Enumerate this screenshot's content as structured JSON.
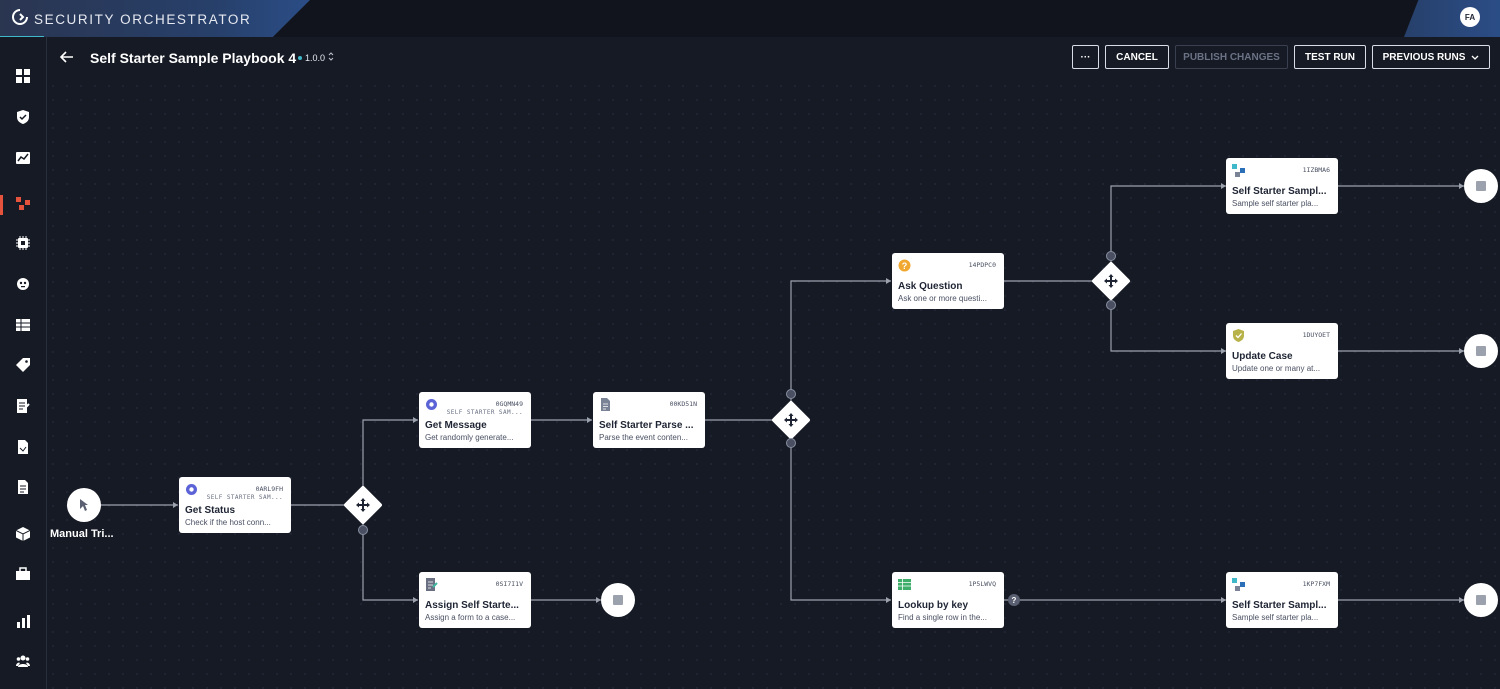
{
  "app": {
    "brand": "SECURITY ORCHESTRATOR",
    "user_initials": "FA"
  },
  "sidebar": {
    "items": [
      {
        "name": "dashboard-icon"
      },
      {
        "name": "shield-icon"
      },
      {
        "name": "chart-icon"
      },
      {
        "name": "playbooks-icon"
      },
      {
        "name": "chip-icon"
      },
      {
        "name": "bug-icon"
      },
      {
        "name": "table-icon"
      },
      {
        "name": "tag-icon"
      },
      {
        "name": "form-icon"
      },
      {
        "name": "file-icon"
      },
      {
        "name": "document-icon"
      },
      {
        "name": "box-icon"
      },
      {
        "name": "toolbox-icon"
      },
      {
        "name": "bar-chart-icon"
      },
      {
        "name": "users-icon"
      }
    ],
    "active_index": 3
  },
  "header": {
    "title": "Self Starter Sample Playbook 4",
    "version": "1.0.0",
    "more_label": "···",
    "cancel_label": "CANCEL",
    "publish_label": "PUBLISH CHANGES",
    "test_run_label": "TEST RUN",
    "previous_runs_label": "PREVIOUS RUNS"
  },
  "colors": {
    "accent": "#3fb8c9",
    "active_nav": "#e5533c",
    "background": "#161a24",
    "node": "#ffffff"
  },
  "trigger": {
    "label": "Manual Tri..."
  },
  "nodes": {
    "get_status": {
      "id": "0ARL9FH",
      "sub": "SELF STARTER SAM...",
      "title": "Get Status",
      "desc": "Check if the host conn...",
      "icon": "gear-icon"
    },
    "get_message": {
      "id": "0GQMN49",
      "sub": "SELF STARTER SAM...",
      "title": "Get Message",
      "desc": "Get randomly generate...",
      "icon": "gear-icon"
    },
    "parse": {
      "id": "00KD51N",
      "sub": "",
      "title": "Self Starter Parse ...",
      "desc": "Parse the event conten...",
      "icon": "document-icon"
    },
    "assign": {
      "id": "0SI7I1V",
      "sub": "",
      "title": "Assign Self Starte...",
      "desc": "Assign a form to a case...",
      "icon": "form-icon"
    },
    "ask_question": {
      "id": "14PDPC0",
      "sub": "",
      "title": "Ask Question",
      "desc": "Ask one or more questi...",
      "icon": "question-icon"
    },
    "lookup": {
      "id": "1P5LWVQ",
      "sub": "",
      "title": "Lookup by key",
      "desc": "Find a single row in the...",
      "icon": "table-icon"
    },
    "sample_top": {
      "id": "1IZBMA6",
      "sub": "",
      "title": "Self Starter Sampl...",
      "desc": "Sample self starter pla...",
      "icon": "playbook-icon"
    },
    "update_case": {
      "id": "1DUYOET",
      "sub": "",
      "title": "Update Case",
      "desc": "Update one or many at...",
      "icon": "shield-icon"
    },
    "sample_bottom": {
      "id": "1KP7FXM",
      "sub": "",
      "title": "Self Starter Sampl...",
      "desc": "Sample self starter pla...",
      "icon": "playbook-icon"
    }
  },
  "condition_marker": "?"
}
